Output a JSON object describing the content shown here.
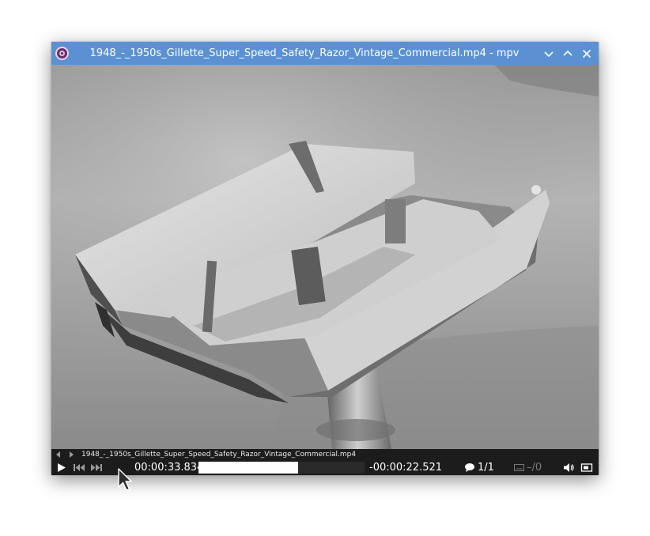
{
  "window": {
    "title": "1948_-_1950s_Gillette_Super_Speed_Safety_Razor_Vintage_Commercial.mp4 - mpv",
    "buttons": [
      "minimize-icon",
      "maximize-icon",
      "close-icon"
    ],
    "titlebar_color": "#5b91d3"
  },
  "osc": {
    "playlist_prev_icon": "triangle-left-icon",
    "playlist_next_icon": "triangle-right-icon",
    "filename": "1948_-_1950s_Gillette_Super_Speed_Safety_Razor_Vintage_Commercial.mp4",
    "play_icon": "play-icon",
    "skip_back_icon": "skip-back-icon",
    "skip_forward_icon": "skip-forward-icon",
    "elapsed": "00:00:33.834",
    "remaining": "-00:00:22.521",
    "seek_progress": 0.6,
    "subtitle_track": "1/1",
    "audio_track": "–/0",
    "volume_icon": "volume-icon",
    "fullscreen_icon": "fullscreen-icon"
  }
}
